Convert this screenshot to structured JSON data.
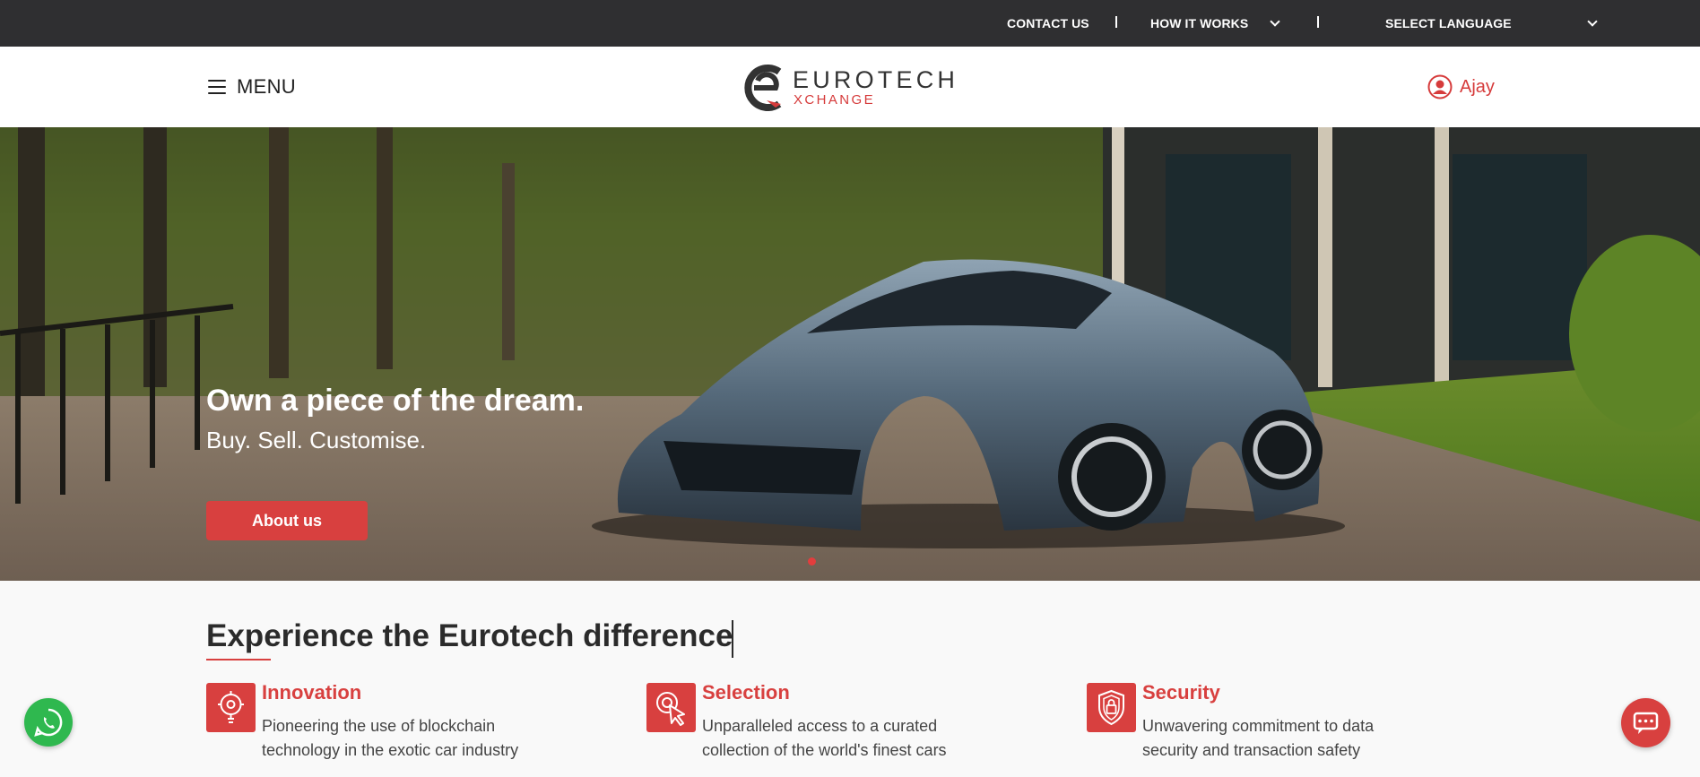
{
  "topbar": {
    "contact": "CONTACT US",
    "how_it_works": "HOW IT WORKS",
    "language": "SELECT LANGUAGE"
  },
  "header": {
    "menu_label": "MENU",
    "logo_line1": "EUROTECH",
    "logo_line2": "XCHANGE",
    "user_name": "Ajay"
  },
  "hero": {
    "title": "Own a piece of the dream.",
    "subtitle": "Buy. Sell. Customise.",
    "button": "About us",
    "slide_count": 1,
    "active_slide": 1
  },
  "section": {
    "title": "Experience the Eurotech difference",
    "features": [
      {
        "title": "Innovation",
        "description": "Pioneering the use of blockchain technology in the exotic car industry",
        "icon": "innovation-icon"
      },
      {
        "title": "Selection",
        "description": "Unparalleled access to a curated collection of the world's finest cars",
        "icon": "selection-icon"
      },
      {
        "title": "Security",
        "description": "Unwavering commitment to data security and transaction safety",
        "icon": "security-icon"
      }
    ]
  },
  "colors": {
    "accent": "#d8403f",
    "topbar": "#2f2f31",
    "whatsapp": "#2fb84f"
  }
}
